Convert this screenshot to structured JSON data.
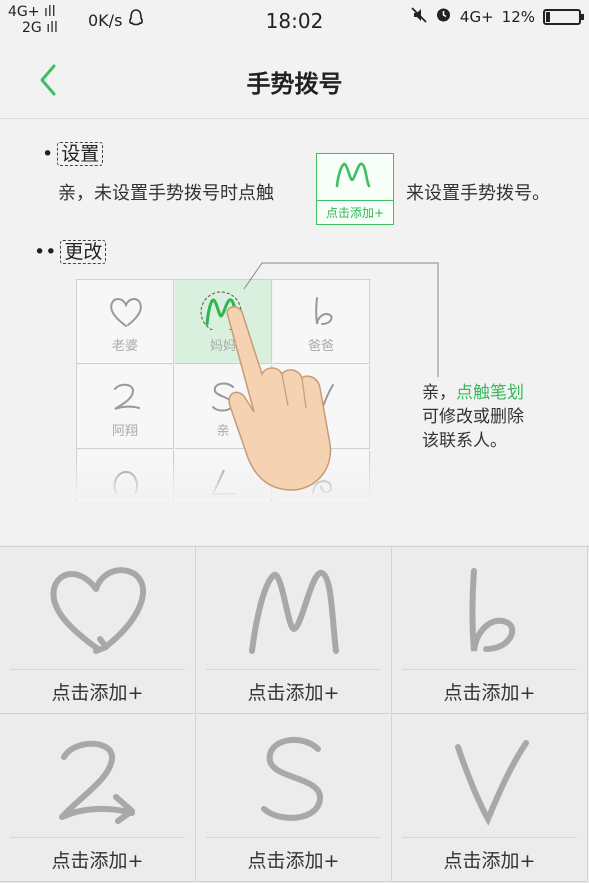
{
  "status_bar": {
    "network_top": "4G+",
    "network_bottom": "2G",
    "speed": "0K/s",
    "time": "18:02",
    "network_right": "4G+",
    "battery": "12%"
  },
  "nav": {
    "title": "手势拨号"
  },
  "instructions": {
    "setup_label": "设置",
    "setup_text_before": "亲，未设置手势拨号时点触",
    "setup_text_after": "来设置手势拨号。",
    "sample_caption": "点击添加+",
    "change_label": "更改",
    "callout_prefix": "亲，",
    "callout_highlight": "点触笔划",
    "callout_line2": "可修改或删除",
    "callout_line3": "该联系人。",
    "demo_cells": [
      {
        "label": "老婆"
      },
      {
        "label": "妈妈"
      },
      {
        "label": "爸爸"
      },
      {
        "label": "阿翔"
      },
      {
        "label": "亲"
      },
      {
        "label": "姐"
      }
    ]
  },
  "gestures": [
    {
      "icon": "heart-gesture-icon",
      "add_label": "点击添加+"
    },
    {
      "icon": "m-gesture-icon",
      "add_label": "点击添加+"
    },
    {
      "icon": "b-gesture-icon",
      "add_label": "点击添加+"
    },
    {
      "icon": "2-gesture-icon",
      "add_label": "点击添加+"
    },
    {
      "icon": "s-gesture-icon",
      "add_label": "点击添加+"
    },
    {
      "icon": "v-gesture-icon",
      "add_label": "点击添加+"
    }
  ],
  "colors": {
    "accent": "#3fbf62",
    "stroke_gray": "#a8a8a8"
  }
}
